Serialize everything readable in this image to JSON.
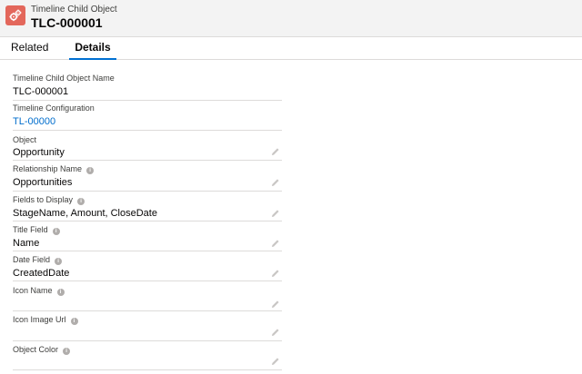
{
  "header": {
    "object_type": "Timeline Child Object",
    "record_name": "TLC-000001",
    "icon": "gears-icon",
    "icon_color": "#e3675b"
  },
  "tabs": [
    {
      "label": "Related",
      "active": false
    },
    {
      "label": "Details",
      "active": true
    }
  ],
  "accent_color": "#0070d2",
  "fields": [
    {
      "label": "Timeline Child Object Name",
      "value": "TLC-000001",
      "info": false,
      "editable": false
    },
    {
      "label": "Timeline Configuration",
      "value": "TL-00000",
      "info": false,
      "editable": false,
      "link": true
    },
    {
      "label": "Object",
      "value": "Opportunity",
      "info": false,
      "editable": true
    },
    {
      "label": "Relationship Name",
      "value": "Opportunities",
      "info": true,
      "editable": true
    },
    {
      "label": "Fields to Display",
      "value": "StageName, Amount, CloseDate",
      "info": true,
      "editable": true
    },
    {
      "label": "Title Field",
      "value": "Name",
      "info": true,
      "editable": true
    },
    {
      "label": "Date Field",
      "value": "CreatedDate",
      "info": true,
      "editable": true
    },
    {
      "label": "Icon Name",
      "value": "",
      "info": true,
      "editable": true
    },
    {
      "label": "Icon Image Url",
      "value": "",
      "info": true,
      "editable": true
    },
    {
      "label": "Object Color",
      "value": "",
      "info": true,
      "editable": true
    }
  ]
}
